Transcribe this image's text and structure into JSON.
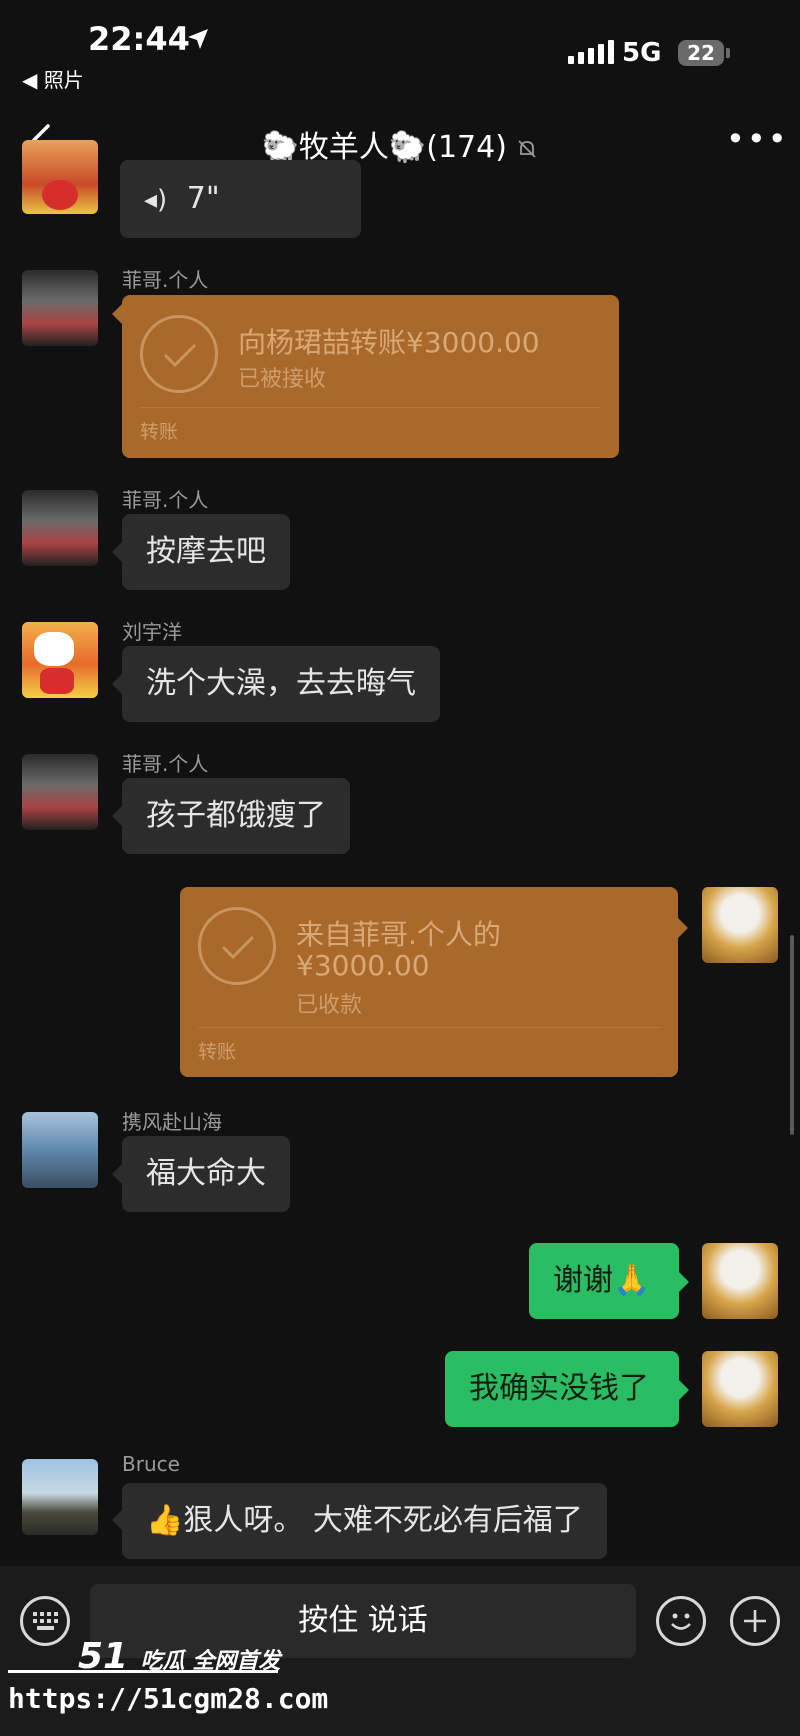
{
  "status_bar": {
    "time": "22:44",
    "back_app": "◀ 照片",
    "network": "5G",
    "battery": "22"
  },
  "header": {
    "title": "🐑牧羊人🐑(174)",
    "more": "•••"
  },
  "messages": [
    {
      "type": "voice",
      "duration": "7\""
    },
    {
      "type": "transfer",
      "sender": "菲哥.个人",
      "line1": "向杨珺喆转账¥3000.00",
      "line2": "已被接收",
      "footer": "转账"
    },
    {
      "type": "text",
      "sender": "菲哥.个人",
      "text": "按摩去吧"
    },
    {
      "type": "text",
      "sender": "刘宇洋",
      "text": "洗个大澡，去去晦气"
    },
    {
      "type": "text",
      "sender": "菲哥.个人",
      "text": "孩子都饿瘦了"
    },
    {
      "type": "transfer_self",
      "line1": "来自菲哥.个人的",
      "line2": "¥3000.00",
      "line3": "已收款",
      "footer": "转账"
    },
    {
      "type": "text",
      "sender": "携风赴山海",
      "text": "福大命大"
    },
    {
      "type": "text_self",
      "text": "谢谢🙏"
    },
    {
      "type": "text_self",
      "text": "我确实没钱了"
    },
    {
      "type": "text",
      "sender": "Bruce",
      "text": "👍狠人呀。 大难不死必有后福了"
    }
  ],
  "input_bar": {
    "hold_to_talk": "按住 说话"
  },
  "watermark": {
    "brand": "51",
    "tagline": "吃瓜 全网首发",
    "url": "https://51cgm28.com"
  },
  "colors": {
    "background": "#111111",
    "bubble_other": "#2c2c2c",
    "bubble_self": "#2bbd64",
    "transfer": "#a9692a"
  },
  "icons": [
    "location-arrow-icon",
    "signal-icon",
    "back-chevron-icon",
    "mute-bell-icon",
    "more-icon",
    "voice-wave-icon",
    "check-icon",
    "keyboard-icon",
    "emoji-icon",
    "plus-icon"
  ]
}
